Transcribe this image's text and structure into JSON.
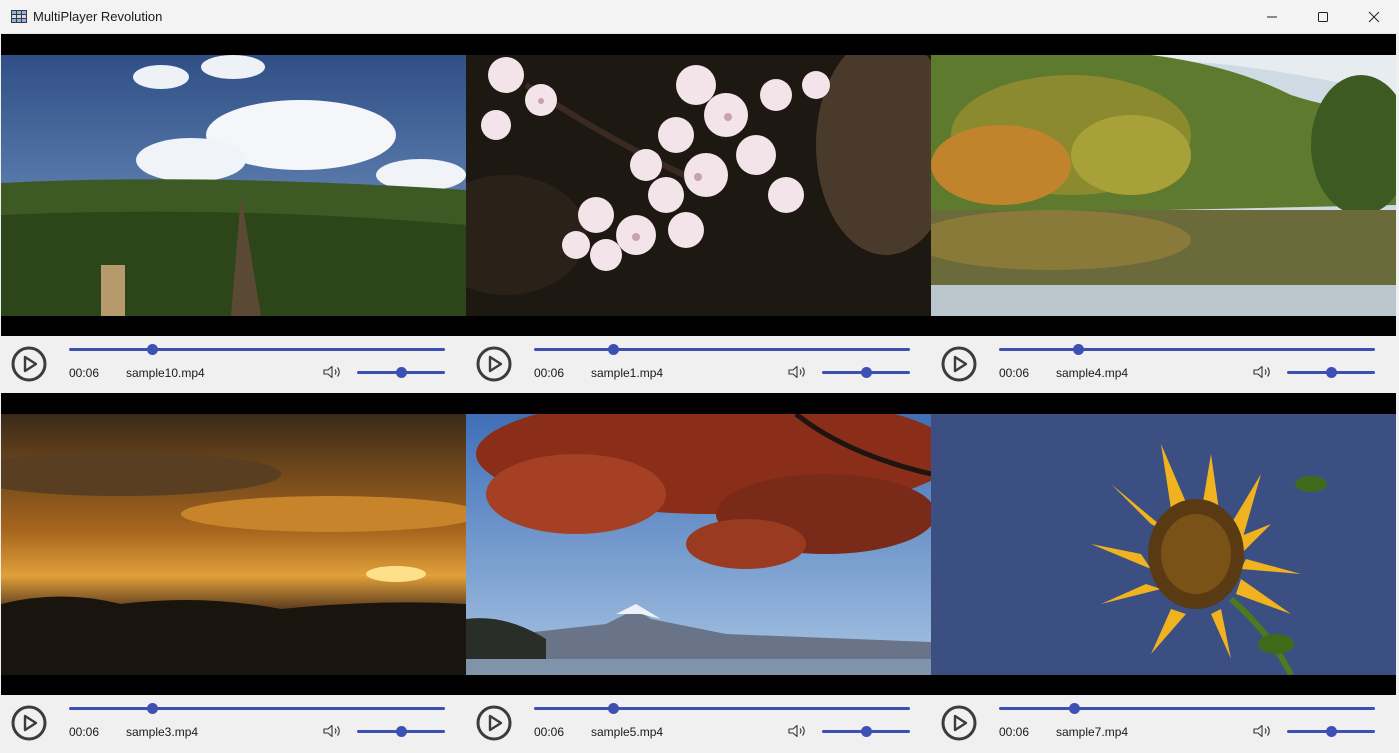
{
  "window": {
    "title": "MultiPlayer Revolution",
    "app_icon": "film-grid-icon",
    "controls": [
      "minimize-icon",
      "maximize-icon",
      "close-icon"
    ]
  },
  "accent_color": "#3e4fb2",
  "players": [
    {
      "file": "sample10.mp4",
      "time": "00:06",
      "progress": 0.22,
      "volume": 0.5,
      "scene": "grassland-under-blue-sky-with-clouds"
    },
    {
      "file": "sample1.mp4",
      "time": "00:06",
      "progress": 0.21,
      "volume": 0.5,
      "scene": "cherry-blossom-branch"
    },
    {
      "file": "sample4.mp4",
      "time": "00:06",
      "progress": 0.21,
      "volume": 0.5,
      "scene": "autumn-forest-reflected-in-lake"
    },
    {
      "file": "sample3.mp4",
      "time": "00:06",
      "progress": 0.22,
      "volume": 0.5,
      "scene": "orange-sunset-over-mountains"
    },
    {
      "file": "sample5.mp4",
      "time": "00:06",
      "progress": 0.21,
      "volume": 0.5,
      "scene": "mount-fuji-with-red-autumn-leaves"
    },
    {
      "file": "sample7.mp4",
      "time": "00:06",
      "progress": 0.2,
      "volume": 0.5,
      "scene": "sunflower-against-blue-sky"
    }
  ]
}
